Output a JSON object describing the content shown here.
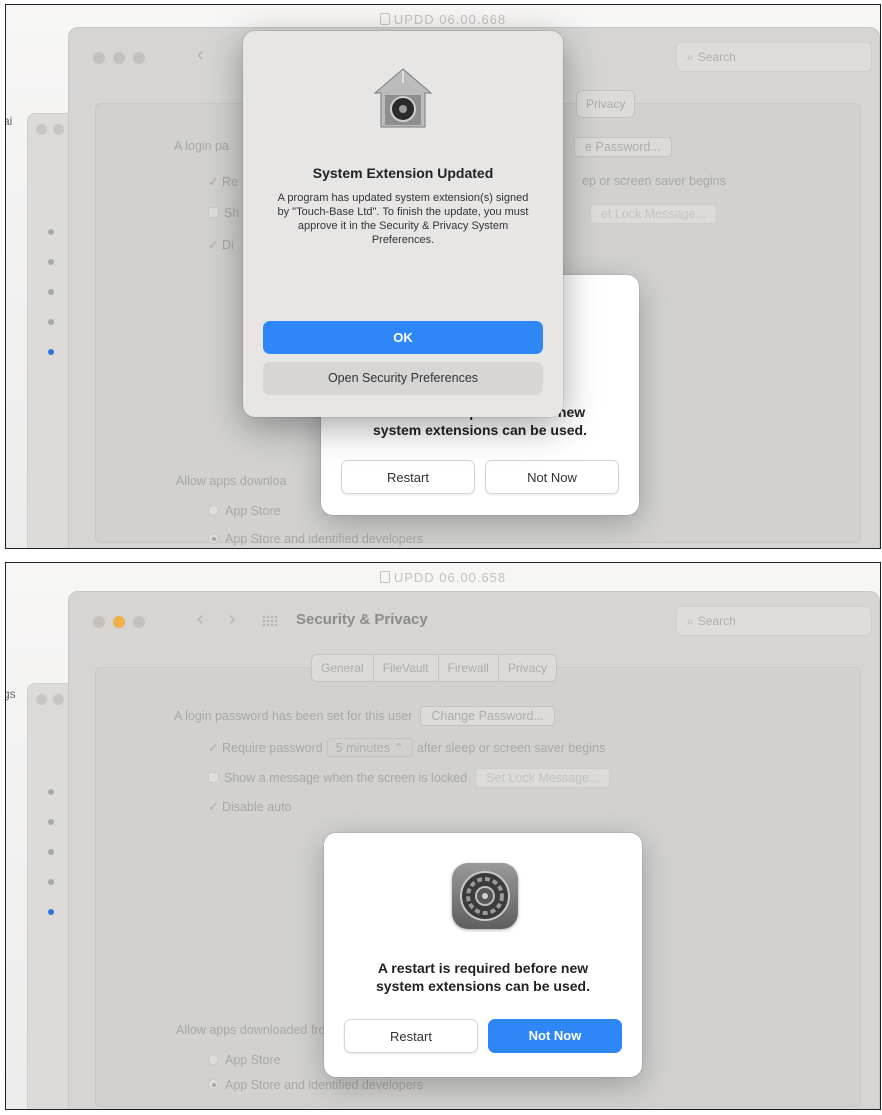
{
  "background": {
    "title1": "UPDD 06.00.668",
    "title2": "UPDD 06.00.658",
    "left_cut_1": "ai",
    "left_cut_2": "gs"
  },
  "window": {
    "title": "Security & Privacy",
    "search_placeholder": "Search",
    "tabs": [
      "General",
      "FileVault",
      "Firewall",
      "Privacy"
    ]
  },
  "general": {
    "login_text": "A login password has been set for this user",
    "change_password": "Change Password...",
    "require_password": "Require password",
    "require_value": "5 minutes",
    "require_suffix": "after sleep or screen saver begins",
    "show_message": "Show a message when the screen is locked",
    "set_lock_message": "Set Lock Message...",
    "disable_auto": "Disable auto",
    "allow_apps": "Allow apps downloaded from:",
    "opt_app_store": "App Store",
    "opt_identified": "App Store and identified developers"
  },
  "panel1_partial": {
    "tab_privacy": "Privacy",
    "change_password": "e Password...",
    "require_tail": "ep or screen saver begins",
    "lock_message": "et Lock Message...",
    "login_prefix": "A login pa",
    "row_re": "Re",
    "row_sh": "Sh",
    "row_di": "Di",
    "allow_prefix": "Allow apps downloa"
  },
  "extension_dialog": {
    "title": "System Extension Updated",
    "body": "A program has updated system extension(s) signed by \"Touch-Base Ltd\". To finish the update, you must approve it in the Security & Privacy System Preferences.",
    "ok": "OK",
    "open_prefs": "Open Security Preferences"
  },
  "restart_dialog": {
    "message_line1": "A restart is required before new",
    "message_line2": "system extensions can be used.",
    "partial_line1": "A restart is required before new",
    "restart": "Restart",
    "not_now": "Not Now"
  }
}
